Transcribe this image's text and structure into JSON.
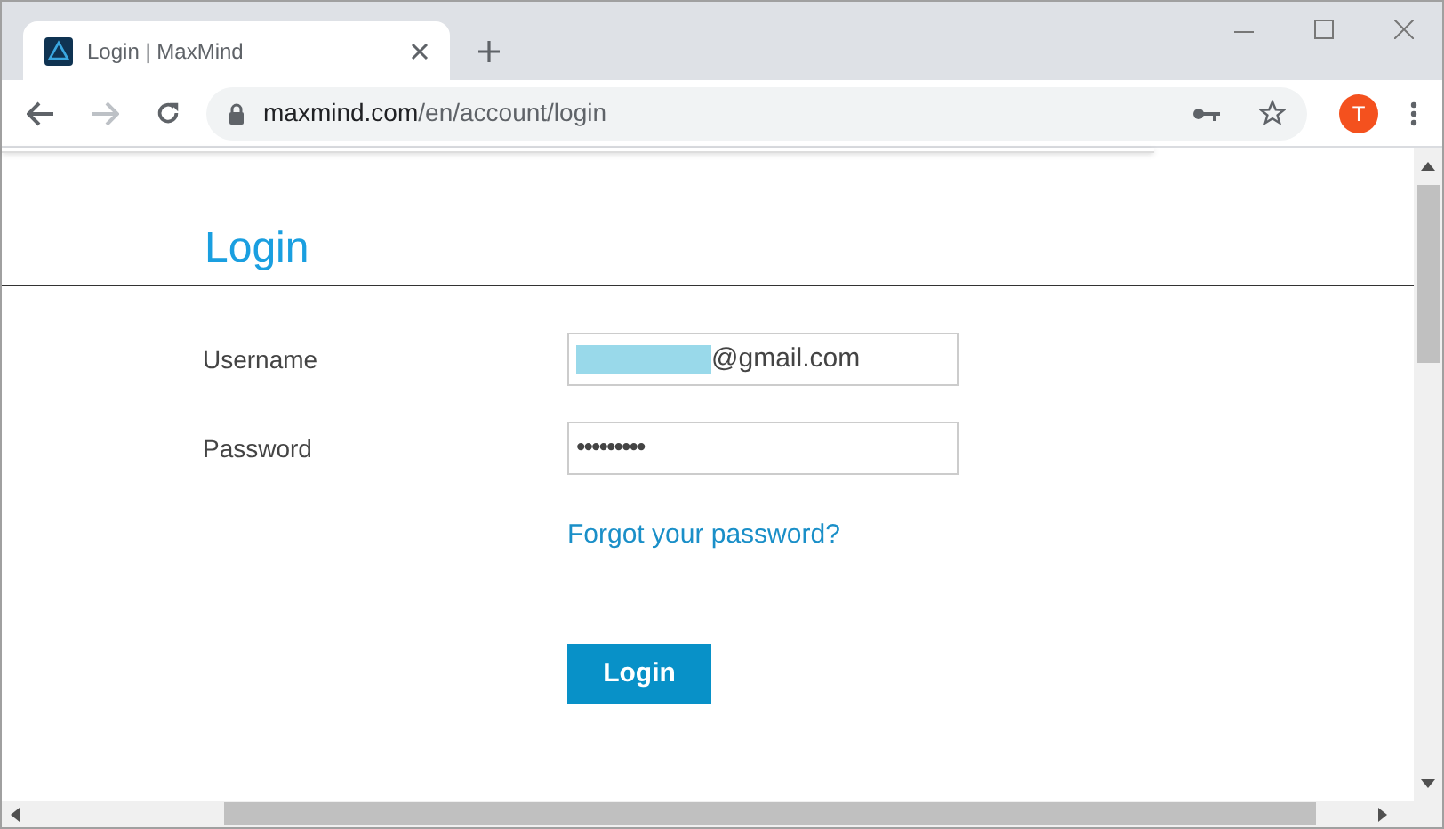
{
  "browser": {
    "tab": {
      "title": "Login | MaxMind"
    },
    "url": {
      "domain": "maxmind.com",
      "path": "/en/account/login"
    },
    "profile_initial": "T"
  },
  "page": {
    "heading": "Login",
    "fields": [
      {
        "label": "Username",
        "value": "@gmail.com",
        "kind": "text"
      },
      {
        "label": "Password",
        "value": "•••••••••",
        "kind": "password"
      }
    ],
    "forgot_link": "Forgot your password?",
    "submit": "Login"
  }
}
